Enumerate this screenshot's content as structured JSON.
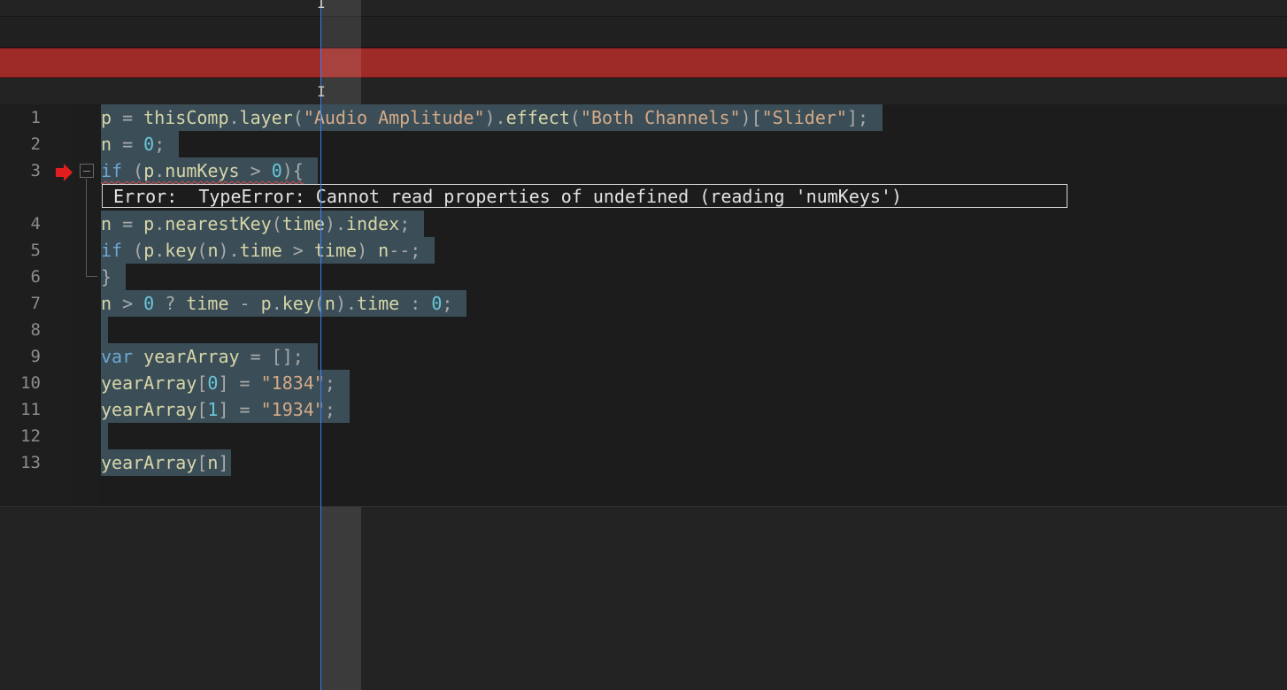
{
  "timeline": {
    "playhead_color": "#3e7ff2",
    "track_color": "#9e2b28"
  },
  "editor": {
    "error_text": "Error:  TypeError: Cannot read properties of undefined (reading 'numKeys')",
    "lines": [
      {
        "num": "1",
        "text": "p = thisComp.layer(\"Audio Amplitude\").effect(\"Both Channels\")[\"Slider\"];"
      },
      {
        "num": "2",
        "text": "n = 0;"
      },
      {
        "num": "3",
        "text": "if (p.numKeys > 0){"
      },
      {
        "num": "4",
        "text": "n = p.nearestKey(time).index;"
      },
      {
        "num": "5",
        "text": "if (p.key(n).time > time) n--;"
      },
      {
        "num": "6",
        "text": "}"
      },
      {
        "num": "7",
        "text": "n > 0 ? time - p.key(n).time : 0;"
      },
      {
        "num": "8",
        "text": ""
      },
      {
        "num": "9",
        "text": "var yearArray = [];"
      },
      {
        "num": "10",
        "text": "yearArray[0] = \"1834\";"
      },
      {
        "num": "11",
        "text": "yearArray[1] = \"1934\";"
      },
      {
        "num": "12",
        "text": ""
      },
      {
        "num": "13",
        "text": "yearArray[n]"
      }
    ],
    "error_line": "3",
    "icons": [
      "error-arrow-icon",
      "fold-collapse-icon",
      "ibeam-cursor-icon"
    ]
  }
}
